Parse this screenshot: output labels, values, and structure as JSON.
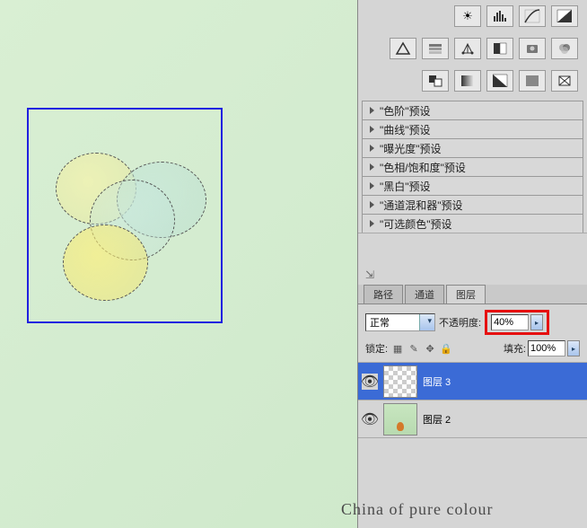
{
  "watermark": "China of pure colour",
  "toolbar_row1_icons": [
    "brightness-contrast",
    "levels",
    "curves",
    "exposure"
  ],
  "toolbar_row2_icons": [
    "vibrance",
    "hue-sat",
    "color-balance",
    "bw",
    "photo-filter",
    "channel-mixer",
    "posterize"
  ],
  "toolbar_row3_icons": [
    "invert",
    "threshold",
    "gradient-map",
    "selective-color",
    "lookup"
  ],
  "presets": {
    "items": [
      "\"色阶\"预设",
      "\"曲线\"预设",
      "\"曝光度\"预设",
      "\"色相/饱和度\"预设",
      "\"黑白\"预设",
      "\"通道混和器\"预设",
      "\"可选颜色\"预设"
    ]
  },
  "tabs": {
    "paths": "路径",
    "channels": "通道",
    "layers": "图层"
  },
  "blend": {
    "selected": "正常"
  },
  "opacity": {
    "label": "不透明度:",
    "value": "40%",
    "arrow": "▸"
  },
  "lock": {
    "label": "锁定:"
  },
  "fill": {
    "label": "填充:",
    "value": "100%",
    "arrow": "▸"
  },
  "layers_list": [
    {
      "name": "图层 3",
      "selected": true,
      "thumb": "checker"
    },
    {
      "name": "图层 2",
      "selected": false,
      "thumb": "green"
    }
  ],
  "highlight_color": "#e61010"
}
